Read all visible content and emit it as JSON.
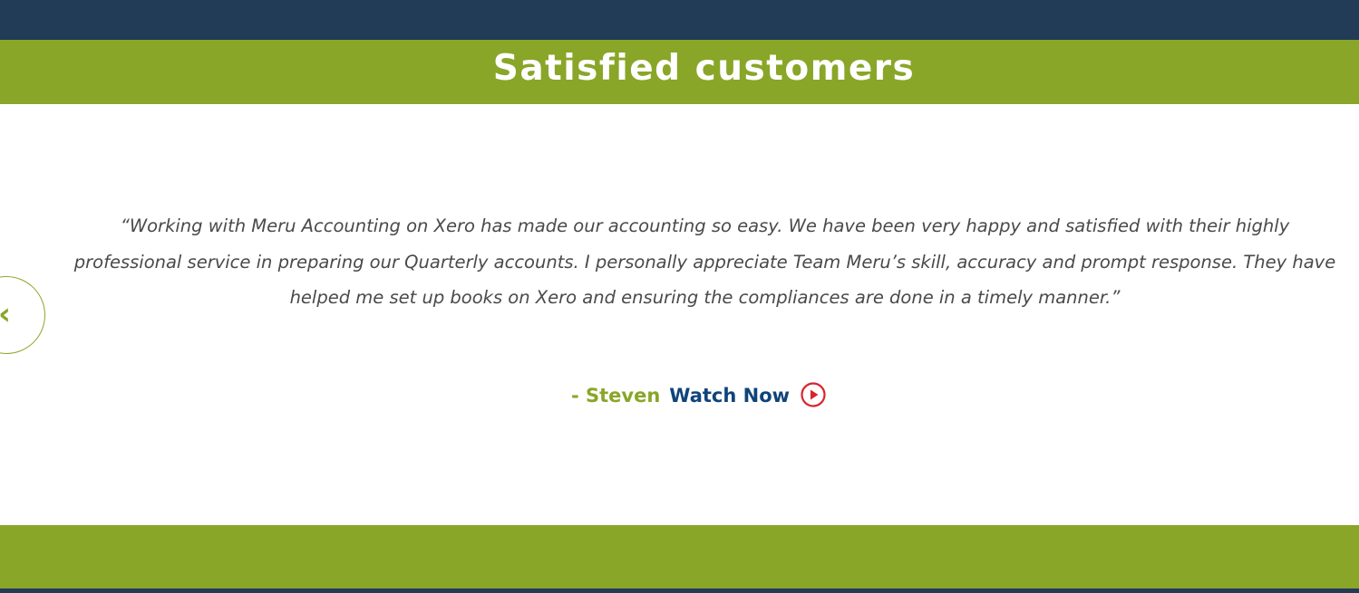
{
  "section": {
    "title": "Satisfied customers"
  },
  "carousel": {
    "prev_glyph": "‹"
  },
  "testimonial": {
    "quote": "“Working with Meru Accounting on Xero has made our accounting so easy. We have been very happy and satisfied with their highly professional service in preparing our Quarterly accounts. I personally appreciate Team Meru’s skill, accuracy and prompt response. They have helped me set up books on Xero and ensuring the compliances are done in a timely manner.”",
    "author": "- Steven",
    "watch_label": "Watch Now"
  },
  "colors": {
    "navy": "#223b57",
    "green": "#89a628",
    "link_blue": "#0f4479",
    "play_red": "#d9232d",
    "quote_text": "#4a4a4a"
  },
  "icons": {
    "prev": "chevron-left-icon",
    "play": "play-circle-icon"
  }
}
